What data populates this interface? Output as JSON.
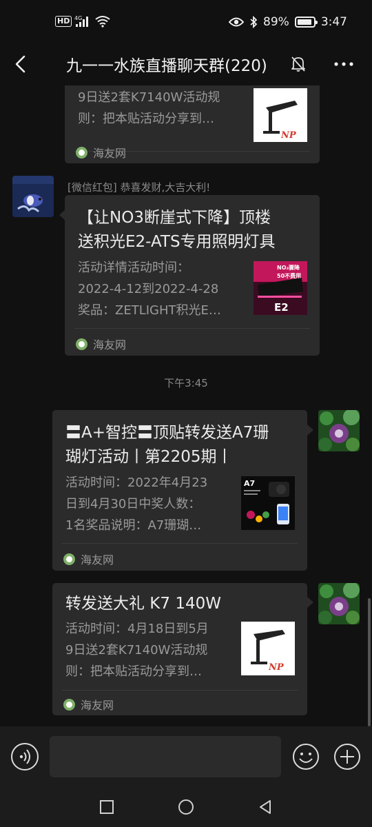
{
  "status_bar": {
    "hd": "HD",
    "network": "4G",
    "battery_percent": "89%",
    "battery_level": 0.89,
    "time": "3:47"
  },
  "header": {
    "title": "九一一水族直播聊天群(220)",
    "back_icon": "back-arrow-icon",
    "mute_icon": "bell-muted-icon",
    "more_icon": "more-dots-icon"
  },
  "messages": [
    {
      "desc": "9日送2套K7140W活动规则：把本贴活动分享到…",
      "desc_line1": "9日送2套K7140W活动规",
      "desc_line2": "则：把本贴活动分享到…",
      "source": "海友网",
      "thumb_text": "NP"
    },
    {
      "sender": "[微信红包] 恭喜发财,大吉大利!",
      "title_line1": "【让NO3断崖式下降】顶楼",
      "title_line2": "送积光E2-ATS专用照明灯具",
      "desc_line1": "活动详情活动时间：",
      "desc_line2": "2022-4-12到2022-4-28",
      "desc_line3": "奖品：ZETLIGHT积光E…",
      "source": "海友网",
      "thumb_text_top": "NO₃骤降",
      "thumb_text_mid": "50不费用",
      "thumb_text_bottom": "E2"
    },
    {
      "timestamp": "下午3:45"
    },
    {
      "title_line1": "〓A+智控〓顶贴转发送A7珊",
      "title_line2": "瑚灯活动丨第2205期丨",
      "desc_line1": "活动时间：2022年4月23",
      "desc_line2": "日到4月30日中奖人数：",
      "desc_line3": "1名奖品说明：A7珊瑚…",
      "source": "海友网",
      "thumb_text": "A7"
    },
    {
      "title_line1": "转发送大礼 K7 140W",
      "desc_line1": "活动时间：4月18日到5月",
      "desc_line2": "9日送2套K7140W活动规",
      "desc_line3": "则：把本贴活动分享到…",
      "source": "海友网",
      "thumb_text": "NP"
    }
  ],
  "input_bar": {
    "voice_icon": "voice-icon",
    "emoji_icon": "emoji-icon",
    "plus_icon": "plus-icon",
    "text_value": ""
  },
  "nav_bar": {
    "recent_icon": "square-icon",
    "home_icon": "circle-icon",
    "back_icon": "triangle-back-icon"
  },
  "colors": {
    "background": "#111111",
    "bubble": "#2b2b2b",
    "text_primary": "#ececec",
    "text_secondary": "#9a9a9a"
  }
}
